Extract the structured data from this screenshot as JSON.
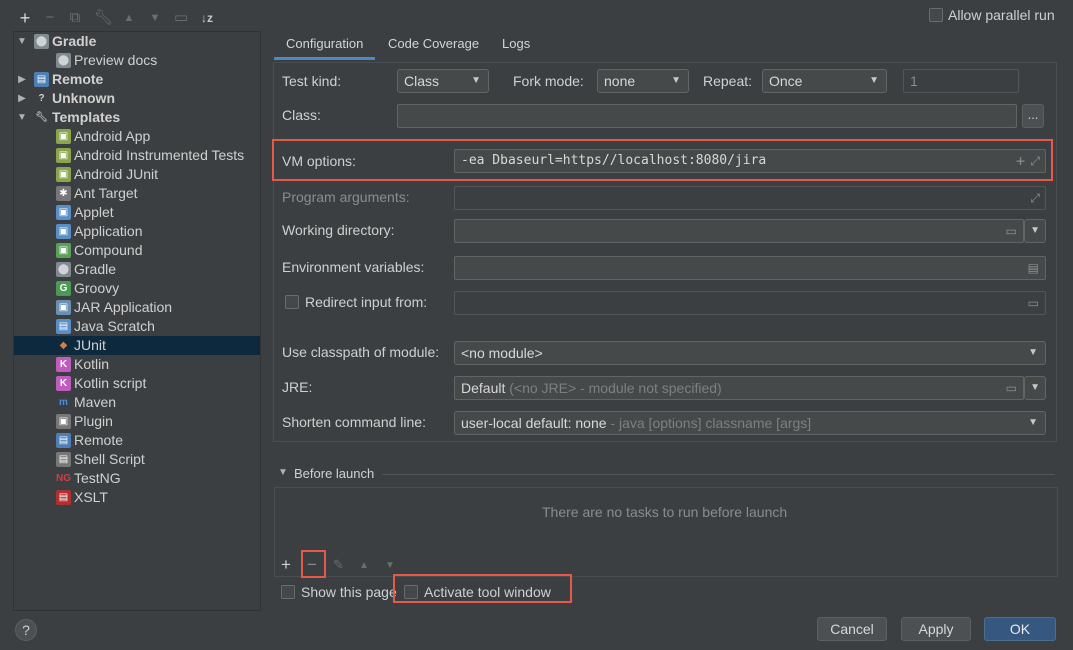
{
  "toolbar": {
    "add_icon": "plus-icon",
    "remove_icon": "minus-icon",
    "copy_icon": "copy-icon",
    "edit_icon": "wrench-icon",
    "move_up_icon": "arrow-up-icon",
    "move_down_icon": "arrow-down-icon",
    "folder_icon": "new-folder-icon",
    "sort_icon": "sort-az-icon",
    "allow_parallel_label": "Allow parallel run"
  },
  "tree": {
    "items": [
      {
        "label": "Gradle",
        "level": 0,
        "expanded": true,
        "bold": true,
        "icon": "gradle-icon"
      },
      {
        "label": "Preview docs",
        "level": 1,
        "icon": "gradle-icon"
      },
      {
        "label": "Remote",
        "level": 0,
        "expanded": false,
        "bold": true,
        "icon": "remote-icon"
      },
      {
        "label": "Unknown",
        "level": 0,
        "expanded": false,
        "bold": true,
        "icon": "question-icon"
      },
      {
        "label": "Templates",
        "level": 0,
        "expanded": true,
        "bold": true,
        "icon": "wrench-icon"
      },
      {
        "label": "Android App",
        "level": 1,
        "icon": "android-app-icon"
      },
      {
        "label": "Android Instrumented Tests",
        "level": 1,
        "icon": "android-tests-icon"
      },
      {
        "label": "Android JUnit",
        "level": 1,
        "icon": "android-junit-icon"
      },
      {
        "label": "Ant Target",
        "level": 1,
        "icon": "ant-icon"
      },
      {
        "label": "Applet",
        "level": 1,
        "icon": "applet-icon"
      },
      {
        "label": "Application",
        "level": 1,
        "icon": "application-icon"
      },
      {
        "label": "Compound",
        "level": 1,
        "icon": "compound-icon"
      },
      {
        "label": "Gradle",
        "level": 1,
        "icon": "gradle-icon"
      },
      {
        "label": "Groovy",
        "level": 1,
        "icon": "groovy-icon"
      },
      {
        "label": "JAR Application",
        "level": 1,
        "icon": "jar-icon"
      },
      {
        "label": "Java Scratch",
        "level": 1,
        "icon": "java-scratch-icon"
      },
      {
        "label": "JUnit",
        "level": 1,
        "icon": "junit-icon",
        "selected": true
      },
      {
        "label": "Kotlin",
        "level": 1,
        "icon": "kotlin-icon"
      },
      {
        "label": "Kotlin script",
        "level": 1,
        "icon": "kotlin-script-icon"
      },
      {
        "label": "Maven",
        "level": 1,
        "icon": "maven-icon"
      },
      {
        "label": "Plugin",
        "level": 1,
        "icon": "plugin-icon"
      },
      {
        "label": "Remote",
        "level": 1,
        "icon": "remote-icon"
      },
      {
        "label": "Shell Script",
        "level": 1,
        "icon": "shell-icon"
      },
      {
        "label": "TestNG",
        "level": 1,
        "icon": "testng-icon"
      },
      {
        "label": "XSLT",
        "level": 1,
        "icon": "xslt-icon"
      }
    ]
  },
  "tabs": [
    "Configuration",
    "Code Coverage",
    "Logs"
  ],
  "config": {
    "test_kind_label": "Test kind:",
    "test_kind_value": "Class",
    "fork_mode_label": "Fork mode:",
    "fork_mode_value": "none",
    "repeat_label": "Repeat:",
    "repeat_value": "Once",
    "repeat_count": "1",
    "class_label": "Class:",
    "class_value": "",
    "browse_label": "...",
    "vm_options_label": "VM options:",
    "vm_options_value": "-ea Dbaseurl=https//localhost:8080/jira",
    "program_args_label": "Program arguments:",
    "program_args_value": "",
    "working_dir_label": "Working directory:",
    "working_dir_value": "",
    "env_vars_label": "Environment variables:",
    "env_vars_value": "",
    "redirect_label": "Redirect input from:",
    "redirect_value": "",
    "classpath_label": "Use classpath of module:",
    "classpath_value": "<no module>",
    "jre_label": "JRE:",
    "jre_value": "Default",
    "jre_hint": "(<no JRE> - module not specified)",
    "shorten_label": "Shorten command line:",
    "shorten_value": "user-local default: none",
    "shorten_hint": "- java [options] classname [args]"
  },
  "before_launch": {
    "title": "Before launch",
    "empty_text": "There are no tasks to run before launch",
    "add_icon": "plus-icon",
    "remove_icon": "minus-icon",
    "edit_icon": "pencil-icon",
    "up_icon": "arrow-up-icon",
    "down_icon": "arrow-down-icon"
  },
  "options": {
    "show_page_label": "Show this page",
    "activate_label": "Activate tool window"
  },
  "footer": {
    "help_label": "?",
    "cancel_label": "Cancel",
    "apply_label": "Apply",
    "ok_label": "OK"
  },
  "colors": {
    "background": "#3c3f41",
    "selection": "#0d293e",
    "accent": "#4a88c7",
    "primary_button": "#365880",
    "highlight": "#e5594b"
  }
}
